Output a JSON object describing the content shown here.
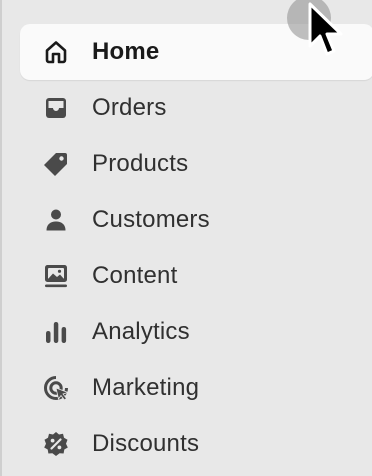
{
  "sidebar": {
    "items": [
      {
        "label": "Home",
        "icon": "home-icon",
        "active": true
      },
      {
        "label": "Orders",
        "icon": "inbox-icon",
        "active": false
      },
      {
        "label": "Products",
        "icon": "tag-icon",
        "active": false
      },
      {
        "label": "Customers",
        "icon": "person-icon",
        "active": false
      },
      {
        "label": "Content",
        "icon": "image-icon",
        "active": false
      },
      {
        "label": "Analytics",
        "icon": "bar-chart-icon",
        "active": false
      },
      {
        "label": "Marketing",
        "icon": "target-icon",
        "active": false
      },
      {
        "label": "Discounts",
        "icon": "discount-badge-icon",
        "active": false
      }
    ]
  },
  "colors": {
    "sidebar_bg": "#e8e8e8",
    "active_bg": "#fafafa",
    "text": "#303030"
  }
}
